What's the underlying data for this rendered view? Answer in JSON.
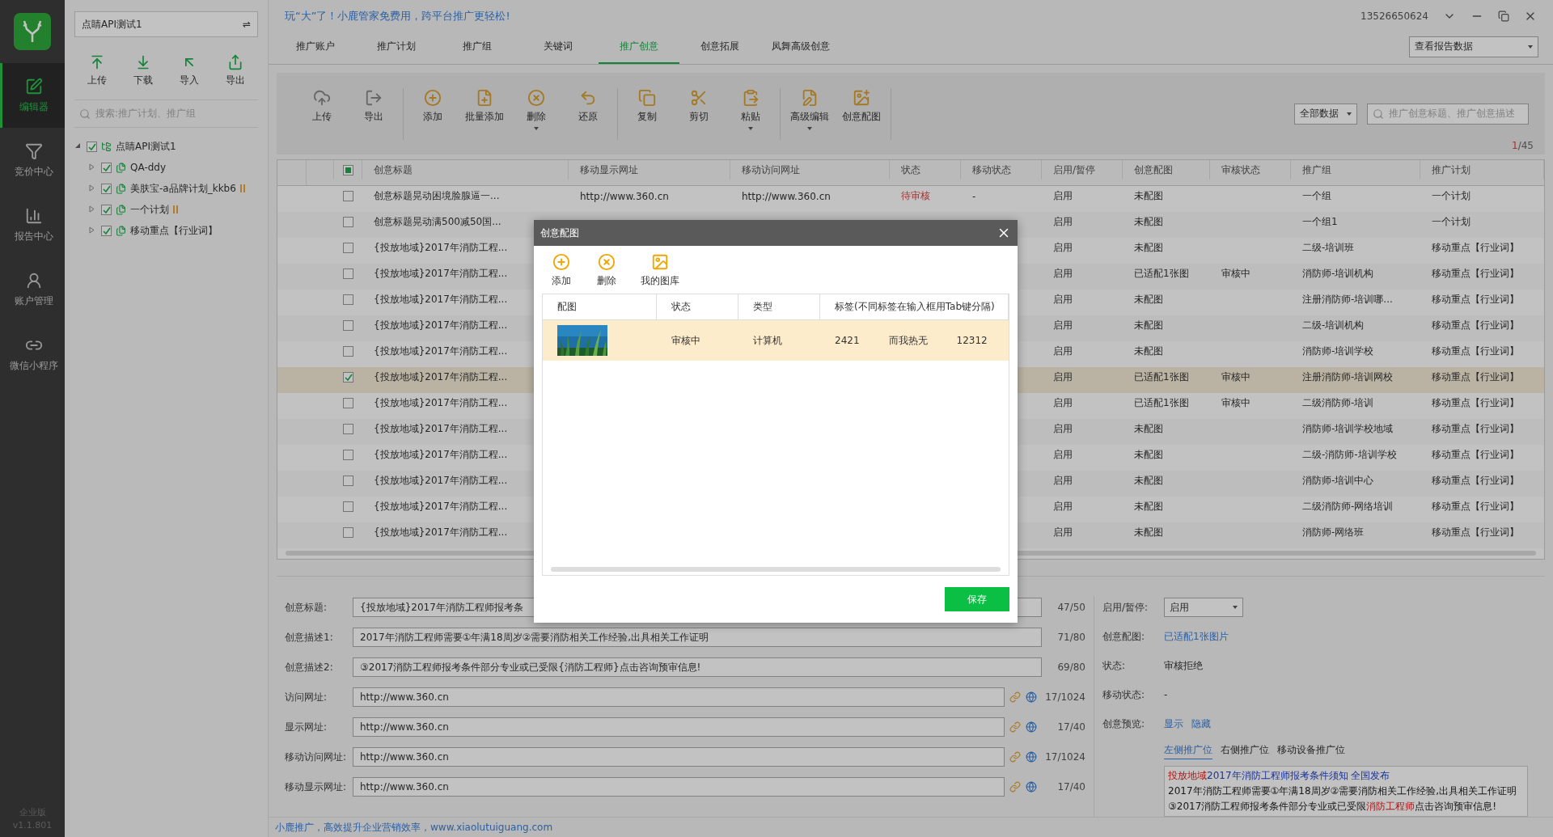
{
  "nav": {
    "items": [
      {
        "label": "编辑器",
        "selected": true
      },
      {
        "label": "竞价中心",
        "selected": false
      },
      {
        "label": "报告中心",
        "selected": false
      },
      {
        "label": "账户管理",
        "selected": false
      },
      {
        "label": "微信小程序",
        "selected": false
      }
    ],
    "edition": "企业版",
    "version": "v1.1.801"
  },
  "account_switch": {
    "value": "点睛API测试1",
    "switch_symbol": "⇌"
  },
  "tree_actions": [
    "上传",
    "下载",
    "导入",
    "导出"
  ],
  "tree_search": {
    "placeholder": "搜索:推广计划、推广组"
  },
  "tree": [
    {
      "label": "点睛API测试1",
      "checked": true,
      "expanded": true,
      "paused": false,
      "children": [
        {
          "label": "QA-ddy",
          "checked": true,
          "expanded": false,
          "paused": false
        },
        {
          "label": "美肤宝-a品牌计划_kkb6",
          "checked": true,
          "expanded": false,
          "paused": true
        },
        {
          "label": "一个计划",
          "checked": true,
          "expanded": false,
          "paused": true
        },
        {
          "label": "移动重点【行业词】",
          "checked": true,
          "expanded": false,
          "paused": false
        }
      ]
    }
  ],
  "slogan": "玩“大”了！小鹿管家免费用，跨平台推广更轻松!",
  "account_phone": "13526650624",
  "tabs": [
    {
      "label": "推广账户",
      "selected": false
    },
    {
      "label": "推广计划",
      "selected": false
    },
    {
      "label": "推广组",
      "selected": false
    },
    {
      "label": "关键词",
      "selected": false
    },
    {
      "label": "推广创意",
      "selected": true
    },
    {
      "label": "创意拓展",
      "selected": false
    },
    {
      "label": "凤舞高级创意",
      "selected": false
    }
  ],
  "report_select": "查看报告数据",
  "toolbar": {
    "groups": [
      [
        {
          "label": "上传",
          "dropdown": false
        },
        {
          "label": "导出",
          "dropdown": false
        }
      ],
      [
        {
          "label": "添加",
          "dropdown": false
        },
        {
          "label": "批量添加",
          "dropdown": false
        },
        {
          "label": "删除",
          "dropdown": true
        },
        {
          "label": "还原",
          "dropdown": false
        }
      ],
      [
        {
          "label": "复制",
          "dropdown": false
        },
        {
          "label": "剪切",
          "dropdown": false
        },
        {
          "label": "粘贴",
          "dropdown": true
        }
      ],
      [
        {
          "label": "高级编辑",
          "dropdown": true
        },
        {
          "label": "创意配图",
          "dropdown": false
        }
      ]
    ],
    "filter": "全部数据",
    "search_placeholder": "推广创意标题、推广创意描述",
    "page_current": "1",
    "page_total": "/45"
  },
  "table": {
    "header_checkbox": {
      "indeterminate": true
    },
    "columns": [
      "创意标题",
      "移动显示网址",
      "移动访问网址",
      "状态",
      "移动状态",
      "启用/暂停",
      "创意配图",
      "审核状态",
      "推广组",
      "推广计划"
    ],
    "rows": [
      {
        "selected": false,
        "cells": [
          "创意标题晃动困境脸腺逼一...",
          "http://www.360.cn",
          "http://www.360.cn",
          "待审核",
          "-",
          "启用",
          "未配图",
          "",
          "一个组",
          "一个计划"
        ]
      },
      {
        "selected": false,
        "cells": [
          "创意标题晃动满500减50国...",
          "",
          "",
          "",
          "",
          "启用",
          "未配图",
          "",
          "一个组1",
          "一个计划"
        ]
      },
      {
        "selected": false,
        "cells": [
          "{投放地域}2017年消防工程...",
          "",
          "",
          "",
          "",
          "启用",
          "未配图",
          "",
          "二级-培训班",
          "移动重点【行业词】"
        ]
      },
      {
        "selected": false,
        "cells": [
          "{投放地域}2017年消防工程...",
          "",
          "",
          "",
          "",
          "启用",
          "已适配1张图",
          "审核中",
          "消防师-培训机构",
          "移动重点【行业词】"
        ]
      },
      {
        "selected": false,
        "cells": [
          "{投放地域}2017年消防工程...",
          "",
          "",
          "",
          "",
          "启用",
          "未配图",
          "",
          "注册消防师-培训哪...",
          "移动重点【行业词】"
        ]
      },
      {
        "selected": false,
        "cells": [
          "{投放地域}2017年消防工程...",
          "",
          "",
          "",
          "",
          "启用",
          "未配图",
          "",
          "二级-培训机构",
          "移动重点【行业词】"
        ]
      },
      {
        "selected": false,
        "cells": [
          "{投放地域}2017年消防工程...",
          "",
          "",
          "",
          "",
          "启用",
          "未配图",
          "",
          "消防师-培训学校",
          "移动重点【行业词】"
        ]
      },
      {
        "selected": true,
        "cells": [
          "{投放地域}2017年消防工程...",
          "",
          "",
          "",
          "",
          "启用",
          "已适配1张图",
          "审核中",
          "注册消防师-培训网校",
          "移动重点【行业词】"
        ]
      },
      {
        "selected": false,
        "cells": [
          "{投放地域}2017年消防工程...",
          "",
          "",
          "",
          "",
          "启用",
          "已适配1张图",
          "审核中",
          "二级消防师-培训",
          "移动重点【行业词】"
        ]
      },
      {
        "selected": false,
        "cells": [
          "{投放地域}2017年消防工程...",
          "",
          "",
          "",
          "",
          "启用",
          "未配图",
          "",
          "消防师-培训学校地域",
          "移动重点【行业词】"
        ]
      },
      {
        "selected": false,
        "cells": [
          "{投放地域}2017年消防工程...",
          "",
          "",
          "",
          "",
          "启用",
          "未配图",
          "",
          "二级-消防师-培训学校",
          "移动重点【行业词】"
        ]
      },
      {
        "selected": false,
        "cells": [
          "{投放地域}2017年消防工程...",
          "",
          "",
          "",
          "",
          "启用",
          "未配图",
          "",
          "消防师-培训中心",
          "移动重点【行业词】"
        ]
      },
      {
        "selected": false,
        "cells": [
          "{投放地域}2017年消防工程...",
          "",
          "",
          "",
          "",
          "启用",
          "未配图",
          "",
          "二级消防师-网络培训",
          "移动重点【行业词】"
        ]
      },
      {
        "selected": false,
        "cells": [
          "{投放地域}2017年消防工程...",
          "",
          "",
          "",
          "",
          "启用",
          "未配图",
          "",
          "消防师-网络班",
          "移动重点【行业词】"
        ]
      }
    ]
  },
  "form": {
    "fields": [
      {
        "label": "创意标题:",
        "value": "{投放地域}2017年消防工程师报考条",
        "counter": "47/50",
        "url_tools": false
      },
      {
        "label": "创意描述1:",
        "value": "2017年消防工程师需要①年满18周岁②需要消防相关工作经验,出具相关工作证明",
        "counter": "71/80",
        "url_tools": false
      },
      {
        "label": "创意描述2:",
        "value": "③2017消防工程师报考条件部分专业或已受限{消防工程师}点击咨询预审信息!",
        "counter": "69/80",
        "url_tools": false
      },
      {
        "label": "访问网址:",
        "value": "http://www.360.cn",
        "counter": "17/1024",
        "url_tools": true
      },
      {
        "label": "显示网址:",
        "value": "http://www.360.cn",
        "counter": "17/40",
        "url_tools": true
      },
      {
        "label": "移动访问网址:",
        "value": "http://www.360.cn",
        "counter": "17/1024",
        "url_tools": true
      },
      {
        "label": "移动显示网址:",
        "value": "http://www.360.cn",
        "counter": "17/40",
        "url_tools": true
      }
    ],
    "enable_label": "启用/暂停:",
    "enable_value": "启用",
    "image_label": "创意配图:",
    "image_link": "已适配1张图片",
    "status_label": "状态:",
    "status_value": "审核拒绝",
    "mobile_status_label": "移动状态:",
    "mobile_status_value": "-",
    "preview_label": "创意预览:",
    "preview_links": [
      "显示",
      "隐藏"
    ],
    "preview_tabs": [
      {
        "label": "左侧推广位",
        "selected": true
      },
      {
        "label": "右侧推广位",
        "selected": false
      },
      {
        "label": "移动设备推广位",
        "selected": false
      }
    ],
    "preview_lines": [
      {
        "kind": "title",
        "segments": [
          {
            "text": "投放地域",
            "highlight": true
          },
          {
            "text": "2017年消防工程师报考条件须知 全国发布",
            "highlight": false
          }
        ]
      },
      {
        "kind": "body",
        "segments": [
          {
            "text": "2017年消防工程师需要①年满18周岁②需要消防相关工作经验,出具相关工作证明",
            "highlight": false
          }
        ]
      },
      {
        "kind": "body",
        "segments": [
          {
            "text": "③2017消防工程师报考条件部分专业或已受限",
            "highlight": false
          },
          {
            "text": "消防工程师",
            "highlight": true
          },
          {
            "text": "点击咨询预审信息!",
            "highlight": false
          }
        ]
      }
    ]
  },
  "status_bar": "小鹿推广，高效提升企业营销效率，www.xiaolutuiguang.com",
  "dialog": {
    "title": "创意配图",
    "actions": [
      "添加",
      "删除",
      "我的图库"
    ],
    "columns": [
      "配图",
      "状态",
      "类型",
      "标签(不同标签在输入框用Tab键分隔)"
    ],
    "rows": [
      {
        "selected": true,
        "image": {
          "kind": "picture"
        },
        "status": "审核中",
        "type": "计算机",
        "tags": [
          "2421",
          "而我热无",
          "12312"
        ]
      }
    ],
    "save": "保存"
  }
}
